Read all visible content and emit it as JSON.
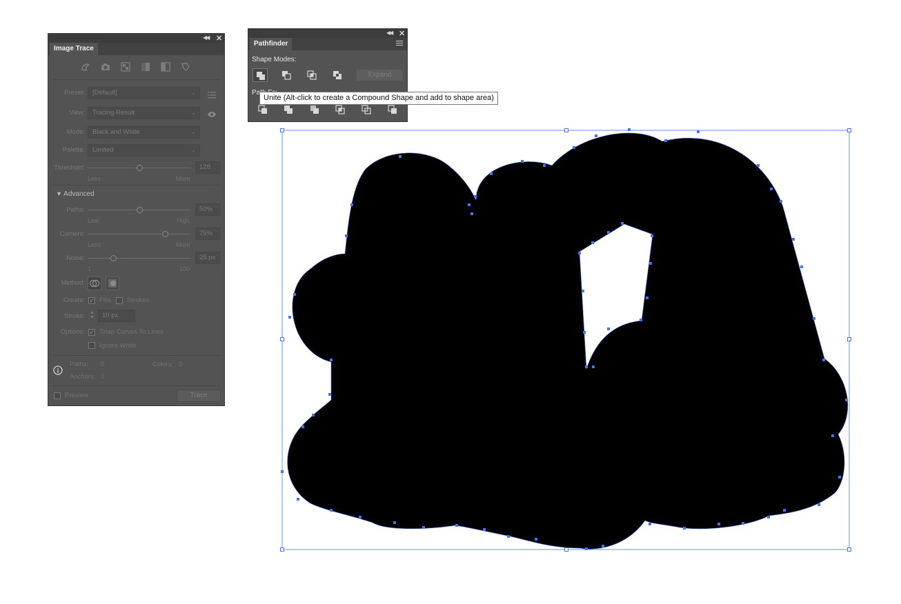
{
  "image_trace": {
    "tab_title": "Image Trace",
    "preset_label": "Preset:",
    "preset_value": "[Default]",
    "view_label": "View:",
    "view_value": "Tracing Result",
    "mode_label": "Mode:",
    "mode_value": "Black and White",
    "palette_label": "Palette:",
    "palette_value": "Limited",
    "threshold_label": "Threshold:",
    "threshold_value": "128",
    "threshold_min": "Less",
    "threshold_max": "More",
    "threshold_fraction": 0.5,
    "advanced_label": "Advanced",
    "paths_label": "Paths:",
    "paths_value": "50%",
    "paths_min": "Low",
    "paths_max": "High",
    "paths_fraction": 0.5,
    "corners_label": "Corners:",
    "corners_value": "75%",
    "corners_min": "Less",
    "corners_max": "More",
    "corners_fraction": 0.75,
    "noise_label": "Noise:",
    "noise_value": "25 px",
    "noise_min": "1",
    "noise_max": "100",
    "noise_fraction": 0.25,
    "method_label": "Method:",
    "create_label": "Create:",
    "fills_label": "Fills",
    "strokes_label": "Strokes",
    "stroke_label": "Stroke:",
    "stroke_value": "10 px",
    "options_label": "Options:",
    "snap_label": "Snap Curves To Lines",
    "ignore_white_label": "Ignore White",
    "stats_paths_label": "Paths:",
    "stats_paths_value": "0",
    "stats_colors_label": "Colors:",
    "stats_colors_value": "0",
    "stats_anchors_label": "Anchors:",
    "stats_anchors_value": "0",
    "preview_label": "Preview",
    "trace_label": "Trace"
  },
  "pathfinder": {
    "tab_title": "Pathfinder",
    "shape_modes_label": "Shape Modes:",
    "expand_label": "Expand",
    "pathfinders_label_partial": "Path  F",
    "pathfinders_label_tail": "s:"
  },
  "tooltip": {
    "text": "Unite (Alt-click to create a Compound Shape and add to shape area)"
  },
  "colors": {
    "selection_blue": "#4a72e8",
    "panel_bg": "#535353",
    "shape_fill": "#000000"
  }
}
